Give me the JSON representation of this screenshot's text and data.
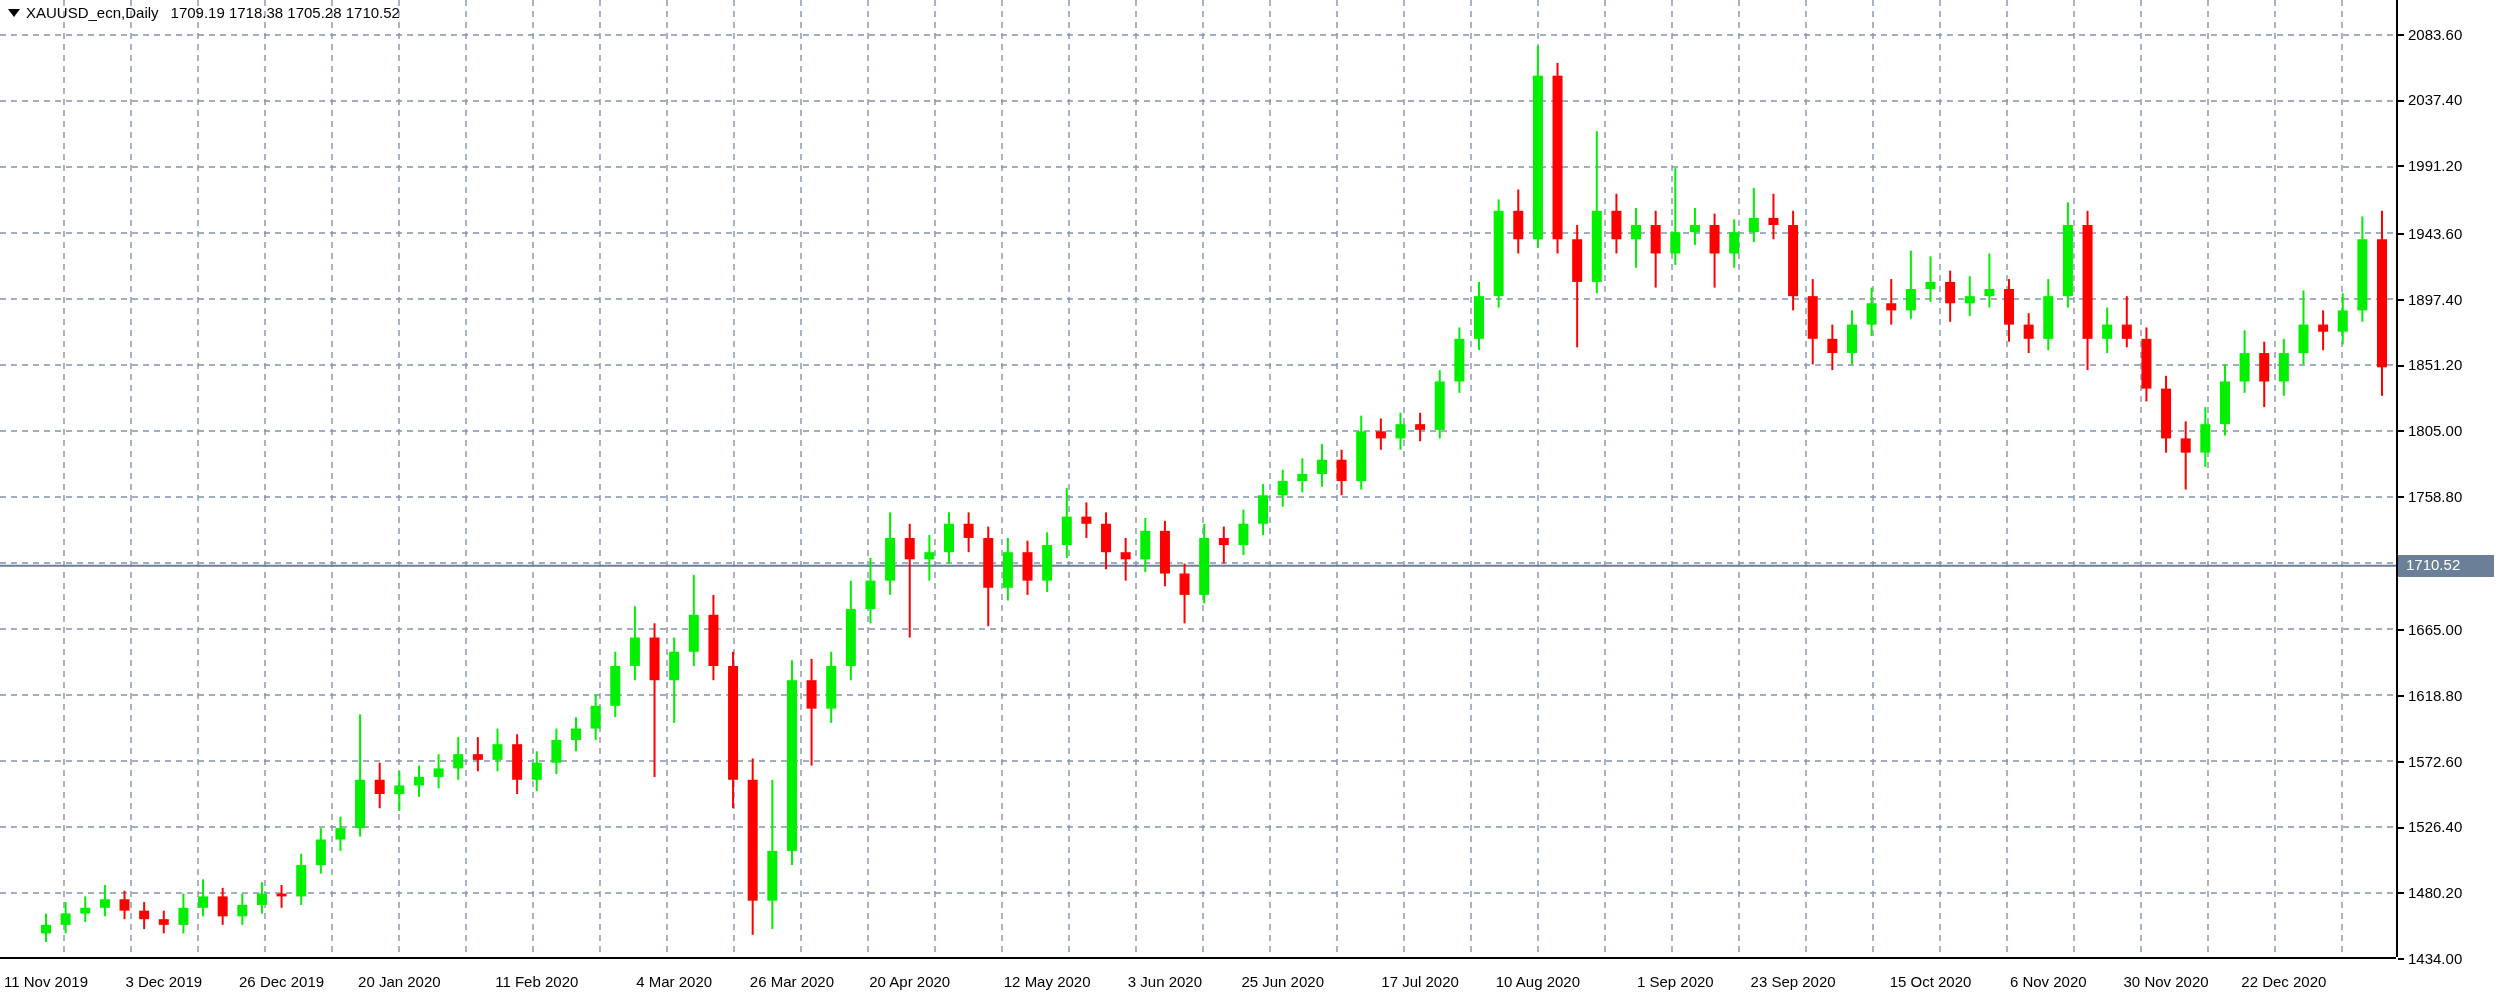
{
  "header": {
    "symbol": "XAUUSD_ecn,Daily",
    "ohlc": "1709.19 1718.38 1705.28 1710.52"
  },
  "chart_data": {
    "type": "candlestick",
    "grid": true,
    "ref_lines": [
      {
        "axis": "y",
        "value": 1710.52,
        "label": "1710.52"
      }
    ],
    "categories": [
      "11 Nov 2019",
      null,
      null,
      null,
      null,
      null,
      "3 Dec 2019",
      null,
      null,
      null,
      null,
      null,
      "26 Dec 2019",
      null,
      null,
      null,
      null,
      null,
      "20 Jan 2020",
      null,
      null,
      null,
      null,
      null,
      null,
      "11 Feb 2020",
      null,
      null,
      null,
      null,
      null,
      null,
      "4 Mar 2020",
      null,
      null,
      null,
      null,
      null,
      "26 Mar 2020",
      null,
      null,
      null,
      null,
      null,
      "20 Apr 2020",
      null,
      null,
      null,
      null,
      null,
      null,
      "12 May 2020",
      null,
      null,
      null,
      null,
      null,
      "3 Jun 2020",
      null,
      null,
      null,
      null,
      null,
      "25 Jun 2020",
      null,
      null,
      null,
      null,
      null,
      null,
      "17 Jul 2020",
      null,
      null,
      null,
      null,
      null,
      "10 Aug 2020",
      null,
      null,
      null,
      null,
      null,
      null,
      "1 Sep 2020",
      null,
      null,
      null,
      null,
      null,
      "23 Sep 2020",
      null,
      null,
      null,
      null,
      null,
      null,
      "15 Oct 2020",
      null,
      null,
      null,
      null,
      null,
      "6 Nov 2020",
      null,
      null,
      null,
      null,
      null,
      "30 Nov 2020",
      null,
      null,
      null,
      null,
      null,
      "22 Dec 2020",
      null,
      null,
      null,
      null,
      null
    ],
    "ylim": [
      1434,
      2083.6
    ],
    "yticks": [
      {
        "value": 2083.6,
        "label": "2083.60"
      },
      {
        "value": 2037.4,
        "label": "2037.40"
      },
      {
        "value": 1991.2,
        "label": "1991.20"
      },
      {
        "value": 1943.6,
        "label": "1943.60"
      },
      {
        "value": 1897.4,
        "label": "1897.40"
      },
      {
        "value": 1851.2,
        "label": "1851.20"
      },
      {
        "value": 1805,
        "label": "1805.00"
      },
      {
        "value": 1758.8,
        "label": "1758.80"
      },
      {
        "value": 1665,
        "label": "1665.00"
      },
      {
        "value": 1618.8,
        "label": "1618.80"
      },
      {
        "value": 1572.6,
        "label": "1572.60"
      },
      {
        "value": 1526.4,
        "label": "1526.40"
      },
      {
        "value": 1480.2,
        "label": "1480.20"
      },
      {
        "value": 1434,
        "label": "1434.00"
      }
    ],
    "ohlc": [
      [
        1452,
        1466,
        1446,
        1458
      ],
      [
        1458,
        1474,
        1452,
        1466
      ],
      [
        1466,
        1478,
        1460,
        1470
      ],
      [
        1470,
        1486,
        1464,
        1476
      ],
      [
        1476,
        1482,
        1462,
        1468
      ],
      [
        1468,
        1474,
        1455,
        1462
      ],
      [
        1462,
        1468,
        1452,
        1458
      ],
      [
        1458,
        1480,
        1452,
        1470
      ],
      [
        1470,
        1490,
        1464,
        1478
      ],
      [
        1478,
        1484,
        1458,
        1464
      ],
      [
        1464,
        1480,
        1458,
        1472
      ],
      [
        1472,
        1488,
        1466,
        1480
      ],
      [
        1480,
        1486,
        1470,
        1478
      ],
      [
        1478,
        1508,
        1472,
        1500
      ],
      [
        1500,
        1526,
        1494,
        1518
      ],
      [
        1518,
        1534,
        1510,
        1526
      ],
      [
        1526,
        1606,
        1520,
        1560
      ],
      [
        1560,
        1572,
        1540,
        1550
      ],
      [
        1550,
        1566,
        1538,
        1556
      ],
      [
        1556,
        1570,
        1548,
        1562
      ],
      [
        1562,
        1578,
        1554,
        1568
      ],
      [
        1568,
        1590,
        1560,
        1578
      ],
      [
        1578,
        1590,
        1566,
        1574
      ],
      [
        1574,
        1596,
        1566,
        1585
      ],
      [
        1585,
        1592,
        1550,
        1560
      ],
      [
        1560,
        1580,
        1552,
        1572
      ],
      [
        1572,
        1596,
        1564,
        1588
      ],
      [
        1588,
        1604,
        1580,
        1596
      ],
      [
        1596,
        1620,
        1588,
        1612
      ],
      [
        1612,
        1650,
        1604,
        1640
      ],
      [
        1640,
        1682,
        1630,
        1660
      ],
      [
        1660,
        1670,
        1562,
        1630
      ],
      [
        1630,
        1660,
        1600,
        1650
      ],
      [
        1650,
        1704,
        1640,
        1676
      ],
      [
        1676,
        1690,
        1630,
        1640
      ],
      [
        1640,
        1650,
        1540,
        1560
      ],
      [
        1560,
        1575,
        1451,
        1475
      ],
      [
        1475,
        1560,
        1455,
        1510
      ],
      [
        1510,
        1644,
        1500,
        1630
      ],
      [
        1630,
        1645,
        1570,
        1610
      ],
      [
        1610,
        1650,
        1600,
        1640
      ],
      [
        1640,
        1700,
        1630,
        1680
      ],
      [
        1680,
        1716,
        1670,
        1700
      ],
      [
        1700,
        1748,
        1690,
        1730
      ],
      [
        1730,
        1740,
        1660,
        1715
      ],
      [
        1715,
        1732,
        1700,
        1720
      ],
      [
        1720,
        1748,
        1712,
        1740
      ],
      [
        1740,
        1748,
        1720,
        1730
      ],
      [
        1730,
        1738,
        1668,
        1695
      ],
      [
        1695,
        1730,
        1686,
        1720
      ],
      [
        1720,
        1728,
        1690,
        1700
      ],
      [
        1700,
        1734,
        1692,
        1725
      ],
      [
        1725,
        1765,
        1716,
        1745
      ],
      [
        1745,
        1755,
        1730,
        1740
      ],
      [
        1740,
        1748,
        1708,
        1720
      ],
      [
        1720,
        1730,
        1700,
        1715
      ],
      [
        1715,
        1744,
        1706,
        1735
      ],
      [
        1735,
        1742,
        1696,
        1705
      ],
      [
        1705,
        1712,
        1670,
        1690
      ],
      [
        1690,
        1740,
        1684,
        1730
      ],
      [
        1730,
        1738,
        1712,
        1725
      ],
      [
        1725,
        1750,
        1718,
        1740
      ],
      [
        1740,
        1768,
        1732,
        1760
      ],
      [
        1760,
        1778,
        1752,
        1770
      ],
      [
        1770,
        1786,
        1762,
        1775
      ],
      [
        1775,
        1796,
        1766,
        1785
      ],
      [
        1785,
        1792,
        1760,
        1770
      ],
      [
        1770,
        1816,
        1764,
        1805
      ],
      [
        1805,
        1814,
        1792,
        1800
      ],
      [
        1800,
        1818,
        1792,
        1810
      ],
      [
        1810,
        1818,
        1798,
        1806
      ],
      [
        1806,
        1848,
        1800,
        1840
      ],
      [
        1840,
        1878,
        1832,
        1870
      ],
      [
        1870,
        1910,
        1862,
        1900
      ],
      [
        1900,
        1968,
        1892,
        1960
      ],
      [
        1960,
        1975,
        1930,
        1940
      ],
      [
        1940,
        2076,
        1934,
        2055
      ],
      [
        2055,
        2064,
        1930,
        1940
      ],
      [
        1940,
        1950,
        1864,
        1910
      ],
      [
        1910,
        2016,
        1902,
        1960
      ],
      [
        1960,
        1972,
        1930,
        1940
      ],
      [
        1940,
        1962,
        1920,
        1950
      ],
      [
        1950,
        1960,
        1906,
        1930
      ],
      [
        1930,
        1990,
        1922,
        1945
      ],
      [
        1945,
        1962,
        1936,
        1950
      ],
      [
        1950,
        1958,
        1906,
        1930
      ],
      [
        1930,
        1954,
        1920,
        1945
      ],
      [
        1945,
        1976,
        1938,
        1955
      ],
      [
        1955,
        1972,
        1940,
        1950
      ],
      [
        1950,
        1960,
        1890,
        1900
      ],
      [
        1900,
        1912,
        1852,
        1870
      ],
      [
        1870,
        1880,
        1848,
        1860
      ],
      [
        1860,
        1890,
        1852,
        1880
      ],
      [
        1880,
        1906,
        1872,
        1895
      ],
      [
        1895,
        1912,
        1880,
        1890
      ],
      [
        1890,
        1932,
        1884,
        1905
      ],
      [
        1905,
        1928,
        1896,
        1910
      ],
      [
        1910,
        1918,
        1882,
        1895
      ],
      [
        1895,
        1914,
        1886,
        1900
      ],
      [
        1900,
        1930,
        1892,
        1905
      ],
      [
        1905,
        1912,
        1868,
        1880
      ],
      [
        1880,
        1888,
        1860,
        1870
      ],
      [
        1870,
        1912,
        1862,
        1900
      ],
      [
        1900,
        1966,
        1892,
        1950
      ],
      [
        1950,
        1960,
        1848,
        1870
      ],
      [
        1870,
        1892,
        1860,
        1880
      ],
      [
        1880,
        1900,
        1864,
        1870
      ],
      [
        1870,
        1878,
        1826,
        1835
      ],
      [
        1835,
        1844,
        1790,
        1800
      ],
      [
        1800,
        1812,
        1764,
        1790
      ],
      [
        1790,
        1822,
        1780,
        1810
      ],
      [
        1810,
        1852,
        1802,
        1840
      ],
      [
        1840,
        1876,
        1832,
        1860
      ],
      [
        1860,
        1868,
        1822,
        1840
      ],
      [
        1840,
        1870,
        1830,
        1860
      ],
      [
        1860,
        1904,
        1852,
        1880
      ],
      [
        1880,
        1890,
        1862,
        1875
      ],
      [
        1875,
        1902,
        1866,
        1890
      ],
      [
        1890,
        1956,
        1882,
        1940
      ],
      [
        1940,
        1960,
        1830,
        1850
      ]
    ]
  }
}
